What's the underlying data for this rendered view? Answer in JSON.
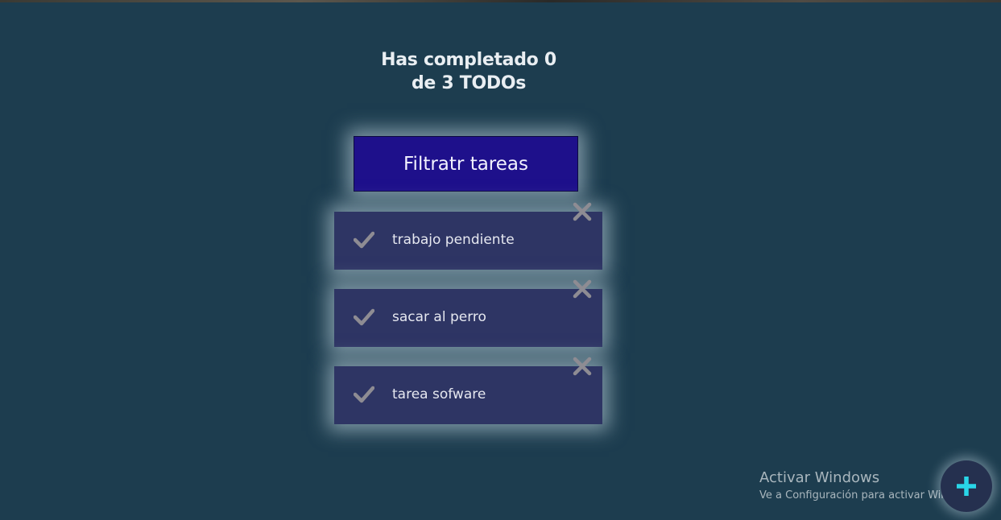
{
  "header": {
    "title_line1": "Has completado 0",
    "title_line2": "de 3 TODOs"
  },
  "filter_button": {
    "label": "Filtratr tareas"
  },
  "todos": [
    {
      "label": "trabajo pendiente",
      "completed": false,
      "icon": "check-icon",
      "delete_icon": "close-icon"
    },
    {
      "label": "sacar al perro",
      "completed": false,
      "icon": "check-icon",
      "delete_icon": "close-icon"
    },
    {
      "label": "tarea sofware",
      "completed": false,
      "icon": "check-icon",
      "delete_icon": "close-icon"
    }
  ],
  "watermark": {
    "title": "Activar Windows",
    "subtitle": "Ve a Configuración para activar Windows."
  },
  "add_button": {
    "icon": "plus-icon"
  },
  "colors": {
    "background": "#1d3d4f",
    "filter_button": "#1e108b",
    "todo_item": "#2e3564",
    "check_icon": "#8e8c93",
    "add_icon": "#29d6e8"
  }
}
